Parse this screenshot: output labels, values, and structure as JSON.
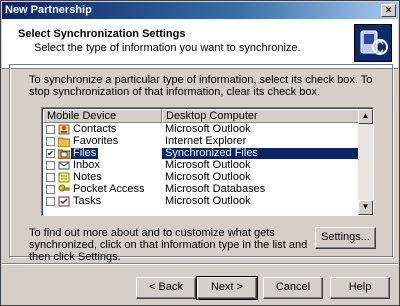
{
  "window": {
    "title": "New Partnership",
    "close_glyph": "×"
  },
  "header": {
    "title": "Select Synchronization Settings",
    "subtitle": "Select the type of information you want to synchronize.",
    "icon": "sync-partnership-icon"
  },
  "instructions": "To synchronize a particular type of information, select its check box. To stop synchronization of that information, clear its check box.",
  "list": {
    "columns": [
      "Mobile Device",
      "Desktop Computer"
    ],
    "rows": [
      {
        "device": "Contacts",
        "desktop": "Microsoft Outlook",
        "checked": false,
        "selected": false,
        "icon": "contacts-icon"
      },
      {
        "device": "Favorites",
        "desktop": "Internet Explorer",
        "checked": false,
        "selected": false,
        "icon": "favorites-folder-icon"
      },
      {
        "device": "Files",
        "desktop": "Synchronized Files",
        "checked": true,
        "selected": true,
        "icon": "files-icon"
      },
      {
        "device": "Inbox",
        "desktop": "Microsoft Outlook",
        "checked": false,
        "selected": false,
        "icon": "inbox-icon"
      },
      {
        "device": "Notes",
        "desktop": "Microsoft Outlook",
        "checked": false,
        "selected": false,
        "icon": "notes-icon"
      },
      {
        "device": "Pocket Access",
        "desktop": "Microsoft Databases",
        "checked": false,
        "selected": false,
        "icon": "key-icon"
      },
      {
        "device": "Tasks",
        "desktop": "Microsoft Outlook",
        "checked": false,
        "selected": false,
        "icon": "tasks-icon"
      }
    ]
  },
  "more_info": "To find out more about and to customize what gets synchronized, click on that information type in the list and then click Settings.",
  "buttons": {
    "settings": "Settings...",
    "back": "< Back",
    "next": "Next >",
    "cancel": "Cancel",
    "help": "Help"
  }
}
